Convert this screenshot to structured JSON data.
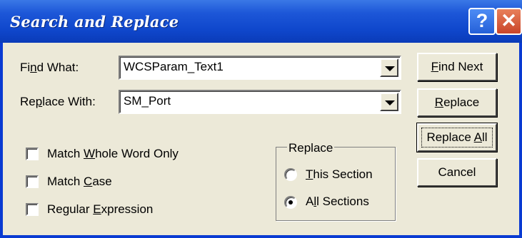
{
  "window": {
    "title": "Search and Replace",
    "help_glyph": "?",
    "close_glyph": "✕"
  },
  "find": {
    "label_pre": "Fi",
    "label_key": "n",
    "label_post": "d What:",
    "value": "WCSParam_Text1"
  },
  "replace": {
    "label_pre": "Re",
    "label_key": "p",
    "label_post": "lace With:",
    "value": "SM_Port"
  },
  "options": {
    "whole_word": {
      "pre": "Match ",
      "key": "W",
      "post": "hole Word Only",
      "checked": false
    },
    "match_case": {
      "pre": "Match ",
      "key": "C",
      "post": "ase",
      "checked": false
    },
    "regex": {
      "pre": "Regular ",
      "key": "E",
      "post": "xpression",
      "checked": false
    }
  },
  "scope": {
    "title": "Replace",
    "this_section": {
      "key": "T",
      "post": "his Section",
      "selected": false
    },
    "all_sections": {
      "pre": "A",
      "key": "l",
      "post": "l Sections",
      "selected": true
    }
  },
  "buttons": {
    "find_next": {
      "key": "F",
      "post": "ind Next"
    },
    "replace": {
      "key": "R",
      "post": "eplace"
    },
    "replace_all": {
      "pre": "Replace ",
      "key": "A",
      "post": "ll"
    },
    "cancel": {
      "label": "Cancel"
    }
  }
}
